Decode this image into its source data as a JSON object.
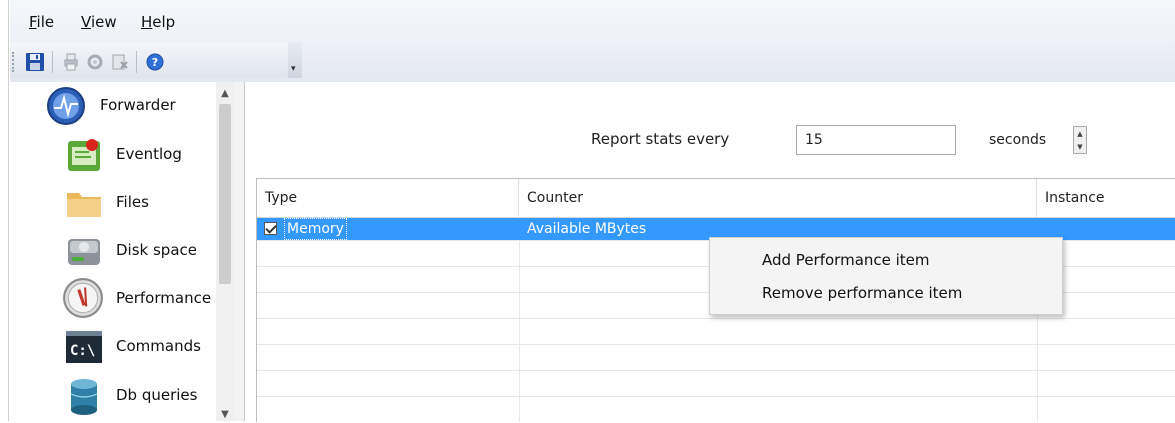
{
  "menu": {
    "items": [
      {
        "label": "File",
        "accel": "F",
        "rest": "ile"
      },
      {
        "label": "View",
        "accel": "V",
        "rest": "iew"
      },
      {
        "label": "Help",
        "accel": "H",
        "rest": "elp"
      }
    ]
  },
  "toolbar": {
    "buttons": [
      "save-icon",
      "print-icon",
      "refresh-icon",
      "delete-icon",
      "help-icon"
    ],
    "overflow_glyph": "▾"
  },
  "sidebar": {
    "items": [
      {
        "label": "Forwarder",
        "icon": "forwarder-icon"
      },
      {
        "label": "Eventlog",
        "icon": "eventlog-icon"
      },
      {
        "label": "Files",
        "icon": "folder-icon"
      },
      {
        "label": "Disk space",
        "icon": "disk-icon"
      },
      {
        "label": "Performance",
        "icon": "performance-icon"
      },
      {
        "label": "Commands",
        "icon": "command-prompt-icon"
      },
      {
        "label": "Db queries",
        "icon": "database-icon"
      }
    ],
    "scroll_up": "▲",
    "scroll_down": "▼"
  },
  "stats": {
    "label": "Report stats every",
    "value": "15",
    "unit": "seconds",
    "spin_up": "▲",
    "spin_down": "▼"
  },
  "table": {
    "columns": [
      "Type",
      "Counter",
      "Instance"
    ],
    "rows": [
      {
        "type": "Memory",
        "counter": "Available MBytes",
        "instance": "",
        "checked": true,
        "selected": true
      }
    ]
  },
  "context_menu": {
    "items": [
      "Add Performance item",
      "Remove performance item"
    ]
  },
  "colors": {
    "selection": "#3399ff",
    "menu_bg": "#f4f4f4"
  }
}
